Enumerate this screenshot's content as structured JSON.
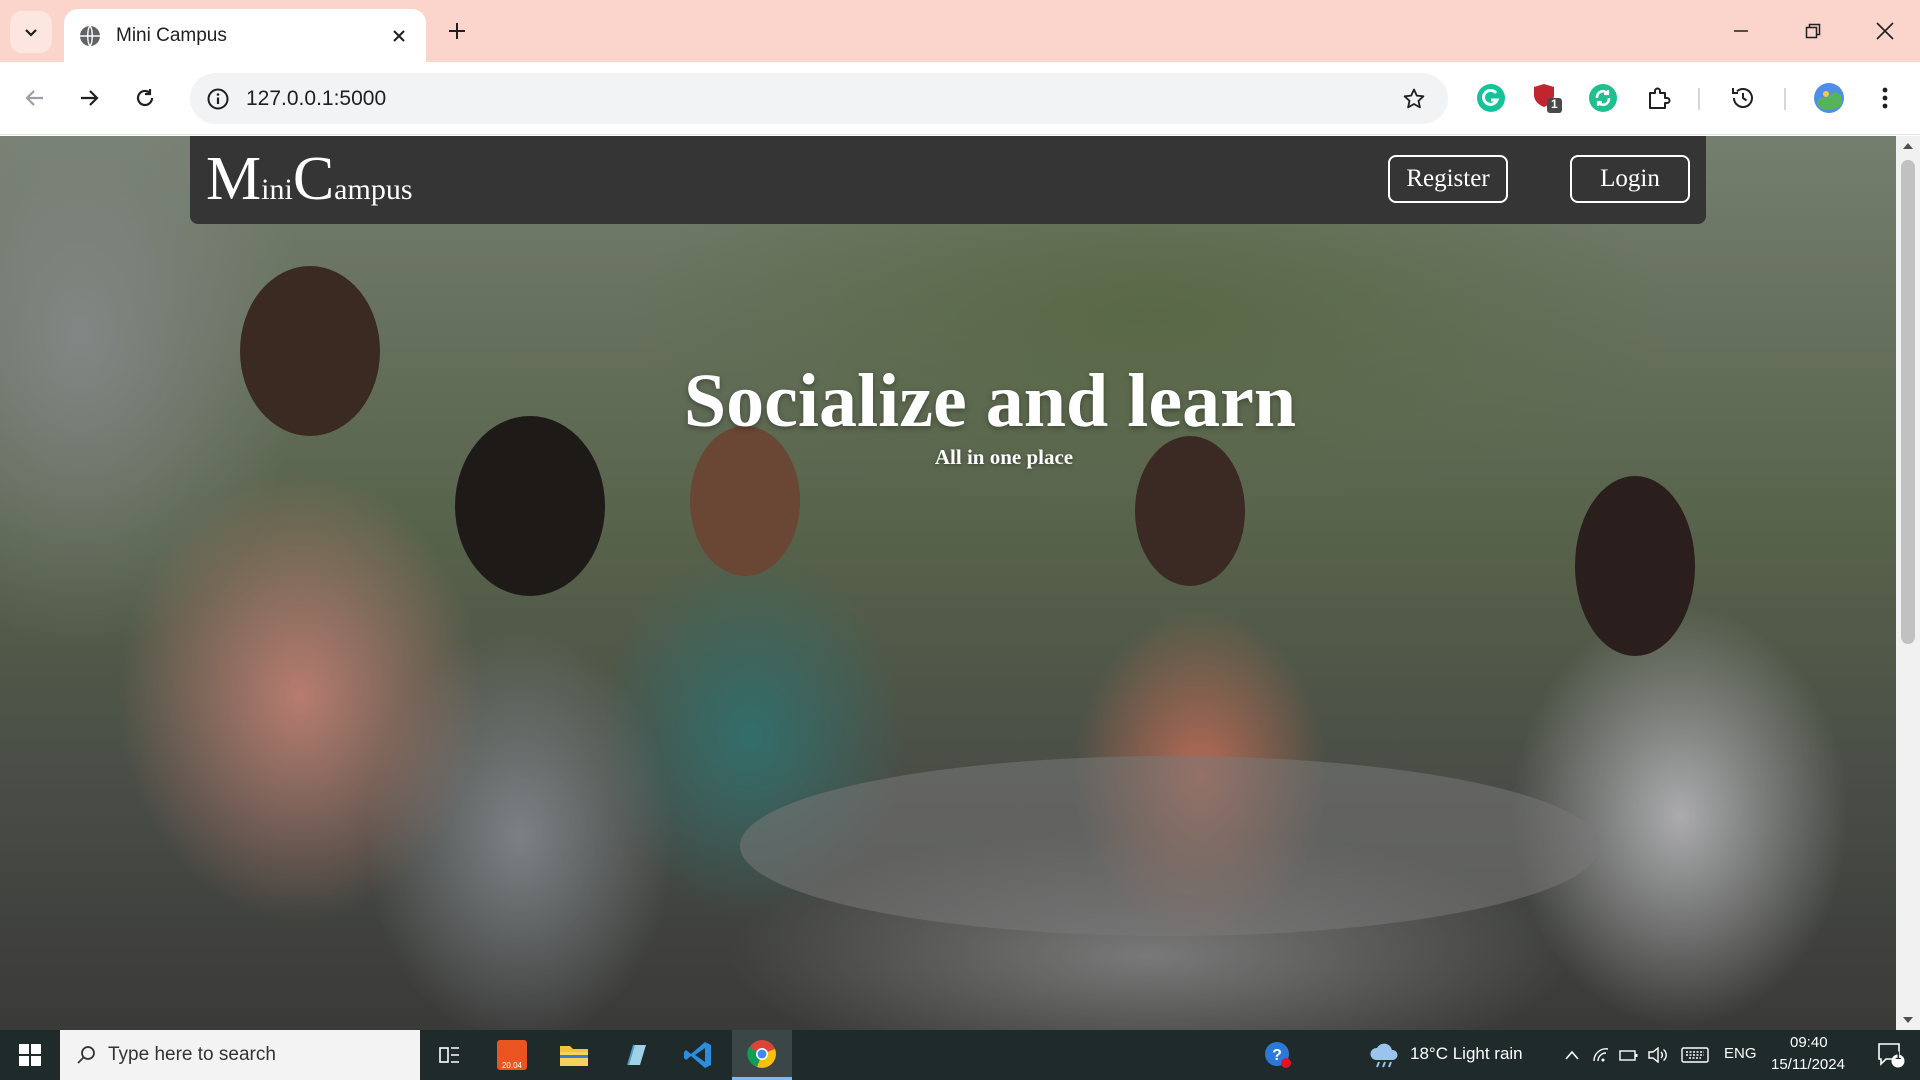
{
  "browser": {
    "tab_title": "Mini Campus",
    "url": "127.0.0.1:5000",
    "extension_badge": "1"
  },
  "site": {
    "brand_first": "M",
    "brand_first_rest": "ini",
    "brand_second": "C",
    "brand_second_rest": "ampus",
    "register_label": "Register",
    "login_label": "Login",
    "hero_title": "Socialize and learn",
    "hero_subtitle": "All in one place"
  },
  "taskbar": {
    "search_placeholder": "Type here to search",
    "weather": "18°C  Light rain",
    "language": "ENG",
    "time": "09:40",
    "date": "15/11/2024",
    "notification_count": "1",
    "ubuntu_badge": "20.04"
  },
  "colors": {
    "tabstrip": "#fbd5cc",
    "navbar": "#353535",
    "taskbar": "#1f2a2a"
  }
}
